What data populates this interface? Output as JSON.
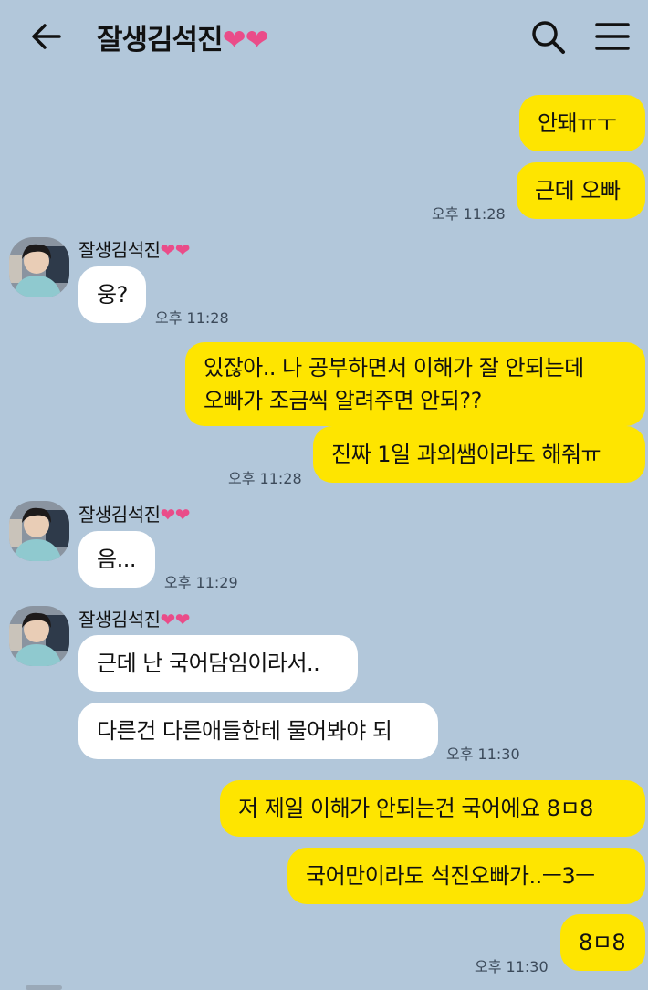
{
  "header": {
    "title": "잘생김석진",
    "title_hearts": "❤❤"
  },
  "contact": {
    "name": "잘생김석진",
    "name_hearts": "❤❤"
  },
  "messages": [
    {
      "from": "me",
      "text": "안돼ㅠㅜ"
    },
    {
      "from": "me",
      "text": "근데 오빠",
      "time": "오후 11:28"
    },
    {
      "from": "them",
      "text": "웅?",
      "time": "오후 11:28"
    },
    {
      "from": "me",
      "lines": [
        "있잖아.. 나 공부하면서 이해가 잘 안되는데",
        "오빠가 조금씩 알려주면 안되??"
      ]
    },
    {
      "from": "me",
      "text": "진짜 1일 과외쌤이라도 해줘ㅠ",
      "time": "오후 11:28"
    },
    {
      "from": "them",
      "text": "음...",
      "time": "오후 11:29"
    },
    {
      "from": "them",
      "text": "근데 난 국어담임이라서.."
    },
    {
      "from": "them",
      "text": "다른건 다른애들한테 물어봐야 되",
      "time": "오후 11:30"
    },
    {
      "from": "me",
      "text": "저 제일 이해가 안되는건 국어에요 8ㅁ8"
    },
    {
      "from": "me",
      "text": "국어만이라도 석진오빠가..ㅡ3ㅡ"
    },
    {
      "from": "me",
      "text": "8ㅁ8",
      "time": "오후 11:30"
    }
  ],
  "colors": {
    "background": "#b2c7da",
    "my_bubble": "#fee500",
    "their_bubble": "#ffffff",
    "heart": "#ea4c89"
  },
  "icons": [
    "back-arrow-icon",
    "search-icon",
    "menu-icon"
  ]
}
